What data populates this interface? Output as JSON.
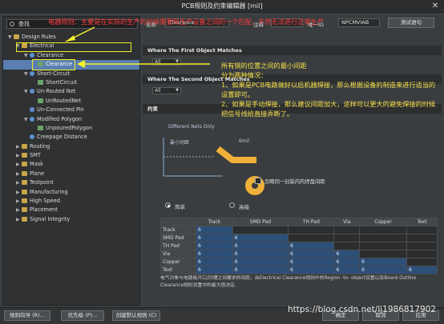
{
  "window": {
    "title": "PCB规则及约束编辑器 [mil]",
    "close_glyph": "✕"
  },
  "search": {
    "label": "查找"
  },
  "tree": [
    {
      "label": "Design Rules",
      "depth": 0,
      "arrow": "▼",
      "icon": "folder-icon"
    },
    {
      "label": "Electrical",
      "depth": 1,
      "arrow": "▼",
      "icon": "folder-icon"
    },
    {
      "label": "Clearance",
      "depth": 2,
      "arrow": "▼",
      "icon": "rule-icon"
    },
    {
      "label": "Clearance",
      "depth": 3,
      "arrow": "",
      "icon": "item-icon",
      "selected": true
    },
    {
      "label": "Short-Circuit",
      "depth": 2,
      "arrow": "▼",
      "icon": "rule-icon"
    },
    {
      "label": "ShortCircuit",
      "depth": 3,
      "arrow": "",
      "icon": "item-icon"
    },
    {
      "label": "Un-Routed Net",
      "depth": 2,
      "arrow": "▼",
      "icon": "rule-icon"
    },
    {
      "label": "UnRoutedNet",
      "depth": 3,
      "arrow": "",
      "icon": "item-icon"
    },
    {
      "label": "Un-Connected Pin",
      "depth": 2,
      "arrow": "",
      "icon": "rule-icon"
    },
    {
      "label": "Modified Polygon",
      "depth": 2,
      "arrow": "▼",
      "icon": "rule-icon"
    },
    {
      "label": "UnpouredPolygon",
      "depth": 3,
      "arrow": "",
      "icon": "item-icon"
    },
    {
      "label": "Creepage Distance",
      "depth": 2,
      "arrow": "",
      "icon": "rule-icon"
    },
    {
      "label": "Routing",
      "depth": 1,
      "arrow": "▶",
      "icon": "folder-icon"
    },
    {
      "label": "SMT",
      "depth": 1,
      "arrow": "▶",
      "icon": "folder-icon"
    },
    {
      "label": "Mask",
      "depth": 1,
      "arrow": "▶",
      "icon": "folder-icon"
    },
    {
      "label": "Plane",
      "depth": 1,
      "arrow": "▶",
      "icon": "folder-icon"
    },
    {
      "label": "Testpoint",
      "depth": 1,
      "arrow": "▶",
      "icon": "folder-icon"
    },
    {
      "label": "Manufacturing",
      "depth": 1,
      "arrow": "▶",
      "icon": "folder-icon"
    },
    {
      "label": "High Speed",
      "depth": 1,
      "arrow": "▶",
      "icon": "folder-icon"
    },
    {
      "label": "Placement",
      "depth": 1,
      "arrow": "▶",
      "icon": "folder-icon"
    },
    {
      "label": "Signal Integrity",
      "depth": 1,
      "arrow": "▶",
      "icon": "folder-icon"
    }
  ],
  "props": {
    "name_label": "名称",
    "name_value": "Clearance",
    "comment_label": "注释",
    "uid_label": "唯一ID",
    "uid_value": "NPCMVIAB",
    "test_btn": "测试语句"
  },
  "sections": {
    "first": "Where The First Object Matches",
    "second": "Where The Second Object Matches",
    "constraint": "约束",
    "dd_value": "All"
  },
  "diagram": {
    "nets_label": "Different Nets Only",
    "min_gap": "最小间距",
    "value": "6mil",
    "ignore_pads": "忽略同一封装内的焊盘间距",
    "simple": "简单",
    "advanced": "高级"
  },
  "matrix": {
    "cols": [
      "",
      "Track",
      "SMD Pad",
      "TH Pad",
      "Via",
      "Copper",
      "Text"
    ],
    "rows": [
      {
        "name": "Track",
        "cells": [
          "6",
          "",
          "",
          "",
          "",
          ""
        ]
      },
      {
        "name": "SMD Pad",
        "cells": [
          "6",
          "6",
          "",
          "",
          "",
          ""
        ]
      },
      {
        "name": "TH Pad",
        "cells": [
          "6",
          "6",
          "6",
          "",
          "",
          ""
        ]
      },
      {
        "name": "Via",
        "cells": [
          "6",
          "6",
          "6",
          "6",
          "",
          ""
        ]
      },
      {
        "name": "Copper",
        "cells": [
          "6",
          "6",
          "6",
          "6",
          "6",
          ""
        ]
      },
      {
        "name": "Text",
        "cells": [
          "6",
          "6",
          "6",
          "6",
          "6",
          "6"
        ]
      }
    ]
  },
  "footer_note": "电气对象与电路板开口/凹槽之间要求的间距，由Electrical Clearance规则中的Region -to- object设置以及Board Outline Clearance规则设置中的最大值决定.",
  "bottom_buttons": {
    "wizard": "规则向导 (R)...",
    "priority": "优先级 (P)...",
    "default": "创建默认规则 (C)",
    "ok": "确定",
    "cancel": "取消",
    "apply": "应用"
  },
  "annotations": {
    "top": "电器规则：主要是在实际的生产的时候需要和生产设备之间的一个匹配，不然无法进行正常生产",
    "right_title": "所有铜的位置之间的最小间距",
    "right_sub": "分为两种情况：",
    "right_1": "1、如果是PCB电路做好以后机器焊接，那么根据设备的制造来进行适当的设置即可。",
    "right_2": "2、如果是手动焊接，那么建议间距加大，这样可以更大的避免焊接的时候把信号线给直接弄断了。"
  },
  "watermark": "https://blog.csdn.net/lj1986817902",
  "colors": {
    "accent": "#f4f02a",
    "pad": "#f0b13a",
    "highlight_blue": "#2c4f78",
    "annotation": "#f7e24a"
  }
}
